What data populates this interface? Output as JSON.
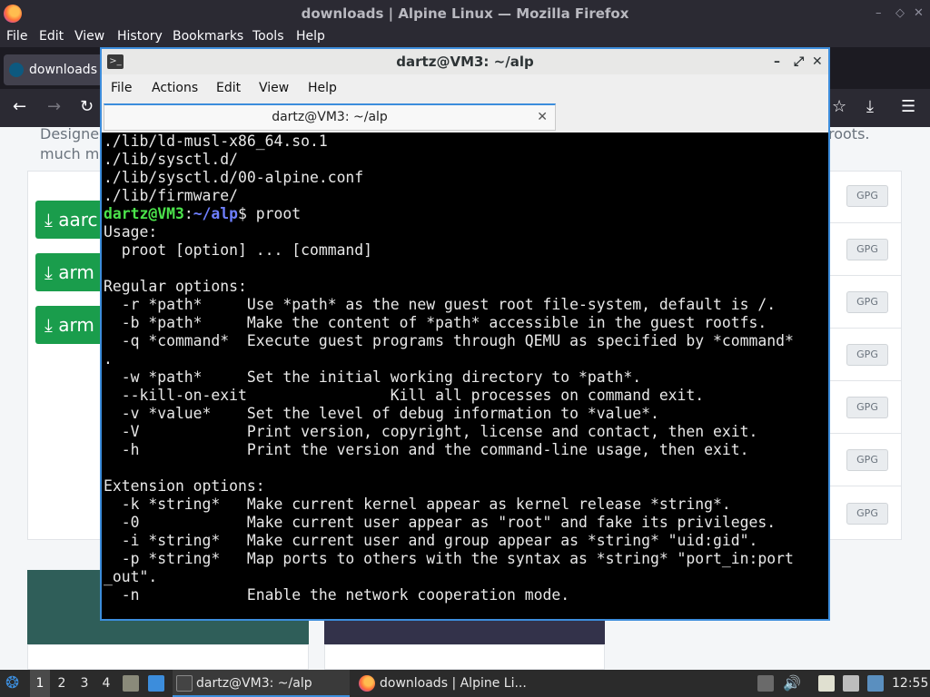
{
  "firefox": {
    "title": "downloads | Alpine Linux — Mozilla Firefox",
    "window_controls": [
      "–",
      "◇",
      "✕"
    ],
    "menu": [
      "File",
      "Edit",
      "View",
      "History",
      "Bookmarks",
      "Tools",
      "Help"
    ],
    "tab_label": "downloads |",
    "page": {
      "intro_line1": "Designe",
      "intro_line1_end": "roots.",
      "intro_line2": "much m",
      "download_buttons": [
        "aarc",
        "arm",
        "arm"
      ],
      "gpg_label": "GPG"
    }
  },
  "terminal": {
    "title": "dartz@VM3: ~/alp",
    "menu": [
      "File",
      "Actions",
      "Edit",
      "View",
      "Help"
    ],
    "tab_label": "dartz@VM3: ~/alp",
    "tab_close": "✕",
    "controls": [
      "–",
      "⤢",
      "✕"
    ],
    "icon_text": ">_",
    "output_before": [
      "./lib/ld-musl-x86_64.so.1",
      "./lib/sysctl.d/",
      "./lib/sysctl.d/00-alpine.conf",
      "./lib/firmware/"
    ],
    "prompt": {
      "user_host": "dartz@VM3",
      "colon": ":",
      "path": "~/alp",
      "symbol": "$ ",
      "command": "proot"
    },
    "output_after": [
      "Usage:",
      "  proot [option] ... [command]",
      "",
      "Regular options:",
      "  -r *path*     Use *path* as the new guest root file-system, default is /.",
      "  -b *path*     Make the content of *path* accessible in the guest rootfs.",
      "  -q *command*  Execute guest programs through QEMU as specified by *command*",
      ".",
      "  -w *path*     Set the initial working directory to *path*.",
      "  --kill-on-exit                Kill all processes on command exit.",
      "  -v *value*    Set the level of debug information to *value*.",
      "  -V            Print version, copyright, license and contact, then exit.",
      "  -h            Print the version and the command-line usage, then exit.",
      "",
      "Extension options:",
      "  -k *string*   Make current kernel appear as kernel release *string*.",
      "  -0            Make current user appear as \"root\" and fake its privileges.",
      "  -i *string*   Make current user and group appear as *string* \"uid:gid\".",
      "  -p *string*   Map ports to others with the syntax as *string* \"port_in:port",
      "_out\".",
      "  -n            Enable the network cooperation mode."
    ]
  },
  "taskbar": {
    "workspaces": [
      "1",
      "2",
      "3",
      "4"
    ],
    "tasks": [
      "dartz@VM3: ~/alp",
      "downloads | Alpine Li..."
    ],
    "clock": "12:55"
  }
}
